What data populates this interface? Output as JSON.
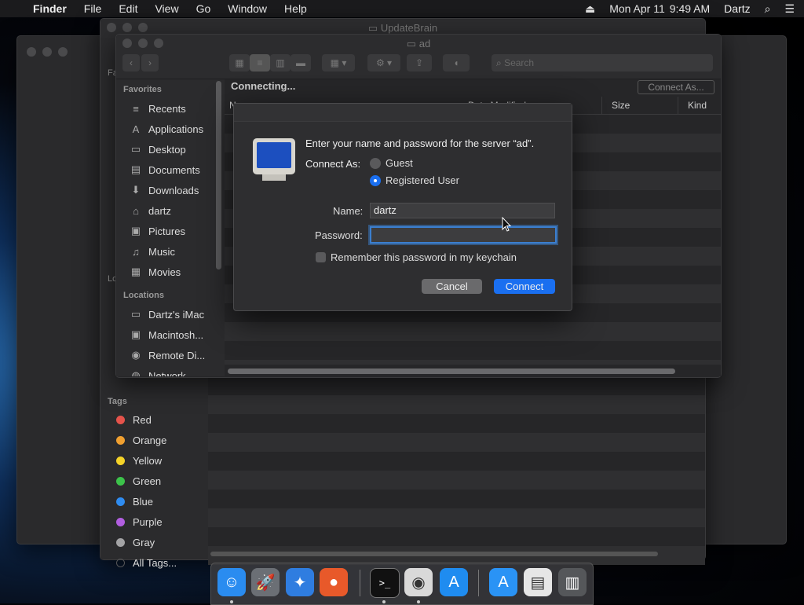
{
  "menubar": {
    "apple": "",
    "app": "Finder",
    "items": [
      "File",
      "Edit",
      "View",
      "Go",
      "Window",
      "Help"
    ],
    "date": "Mon Apr 11",
    "time": "9:49 AM",
    "user": "Dartz"
  },
  "back_window": {
    "title": "UpdateBrain",
    "sidebar_sections": {
      "favorites_partial": "Fa",
      "locations_partial": "Lo",
      "tags": "Tags"
    },
    "tags": [
      {
        "label": "Red",
        "color": "#e5534b"
      },
      {
        "label": "Orange",
        "color": "#f0a030"
      },
      {
        "label": "Yellow",
        "color": "#f5d328"
      },
      {
        "label": "Green",
        "color": "#3cc34a"
      },
      {
        "label": "Blue",
        "color": "#2f8cf0"
      },
      {
        "label": "Purple",
        "color": "#b15ee0"
      },
      {
        "label": "Gray",
        "color": "#a3a3a5"
      },
      {
        "label": "All Tags...",
        "color": "#555557"
      }
    ]
  },
  "front_window": {
    "title": "ad",
    "search_placeholder": "Search",
    "status": "Connecting...",
    "connect_as_button": "Connect As...",
    "columns": {
      "name": "N",
      "date": "Date Modified",
      "size": "Size",
      "kind": "Kind"
    },
    "favorites_header": "Favorites",
    "favorites": [
      {
        "label": "Recents",
        "icon": "clock-icon",
        "glyph": "≡"
      },
      {
        "label": "Applications",
        "icon": "applications-icon",
        "glyph": "A"
      },
      {
        "label": "Desktop",
        "icon": "desktop-icon",
        "glyph": "▭"
      },
      {
        "label": "Documents",
        "icon": "documents-icon",
        "glyph": "▤"
      },
      {
        "label": "Downloads",
        "icon": "downloads-icon",
        "glyph": "⬇"
      },
      {
        "label": "dartz",
        "icon": "home-icon",
        "glyph": "⌂"
      },
      {
        "label": "Pictures",
        "icon": "pictures-icon",
        "glyph": "▣"
      },
      {
        "label": "Music",
        "icon": "music-icon",
        "glyph": "♫"
      },
      {
        "label": "Movies",
        "icon": "movies-icon",
        "glyph": "▦"
      }
    ],
    "locations_header": "Locations",
    "locations": [
      {
        "label": "Dartz's iMac",
        "icon": "computer-icon",
        "glyph": "▭"
      },
      {
        "label": "Macintosh...",
        "icon": "disk-icon",
        "glyph": "▣"
      },
      {
        "label": "Remote Di...",
        "icon": "remote-disc-icon",
        "glyph": "◉"
      },
      {
        "label": "Network",
        "icon": "network-icon",
        "glyph": "◍"
      }
    ]
  },
  "dialog": {
    "message": "Enter your name and password for the server “ad”.",
    "connect_as_label": "Connect As:",
    "options": [
      "Guest",
      "Registered User"
    ],
    "selected_option": "Registered User",
    "name_label": "Name:",
    "name_value": "dartz",
    "password_label": "Password:",
    "password_value": "",
    "remember_label": "Remember this password in my keychain",
    "remember_checked": false,
    "cancel": "Cancel",
    "connect": "Connect",
    "accent": "#1a6ff0"
  },
  "dock": {
    "apps": [
      {
        "name": "finder-icon",
        "glyph": "☺",
        "color": "#2a8cf0",
        "running": true
      },
      {
        "name": "launchpad-icon",
        "glyph": "🚀",
        "color": "#6b6f75",
        "running": false
      },
      {
        "name": "safari-icon",
        "glyph": "✦",
        "color": "#2f7de0",
        "running": false
      },
      {
        "name": "firefox-icon",
        "glyph": "●",
        "color": "#e8592a",
        "running": false
      },
      {
        "name": "terminal-icon",
        "glyph": ">_",
        "color": "#111",
        "running": true
      },
      {
        "name": "chrome-icon",
        "glyph": "◉",
        "color": "#d9d9d9",
        "running": true
      },
      {
        "name": "app-store-icon",
        "glyph": "A",
        "color": "#1f8cf0",
        "running": false
      },
      {
        "name": "app-store-downloads-icon",
        "glyph": "A",
        "color": "#2a93f5",
        "running": false
      },
      {
        "name": "document-icon",
        "glyph": "▤",
        "color": "#e6e6e6",
        "running": false
      },
      {
        "name": "trash-icon",
        "glyph": "▥",
        "color": "#55575a",
        "running": false
      }
    ]
  }
}
